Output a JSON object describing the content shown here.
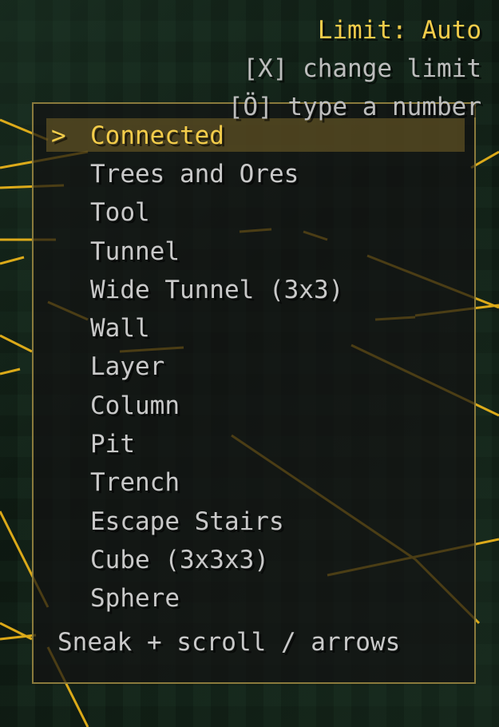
{
  "hud": {
    "limit": "Limit: Auto",
    "change_limit_hint": "[X] change limit",
    "type_number_hint": "[Ö] type a number"
  },
  "menu": {
    "cursor": ">",
    "selected_index": 0,
    "items": [
      {
        "label": "Connected"
      },
      {
        "label": "Trees and Ores"
      },
      {
        "label": "Tool"
      },
      {
        "label": "Tunnel"
      },
      {
        "label": "Wide Tunnel (3x3)"
      },
      {
        "label": "Wall"
      },
      {
        "label": "Layer"
      },
      {
        "label": "Column"
      },
      {
        "label": "Pit"
      },
      {
        "label": "Trench"
      },
      {
        "label": "Escape Stairs"
      },
      {
        "label": "Cube (3x3x3)"
      },
      {
        "label": "Sphere"
      }
    ],
    "footer": "Sneak + scroll / arrows"
  },
  "colors": {
    "accent": "#f3cc4a",
    "text": "#c9c9c9",
    "panel_border": "#8a7a3c",
    "highlight_lines": "#ffc21a"
  }
}
